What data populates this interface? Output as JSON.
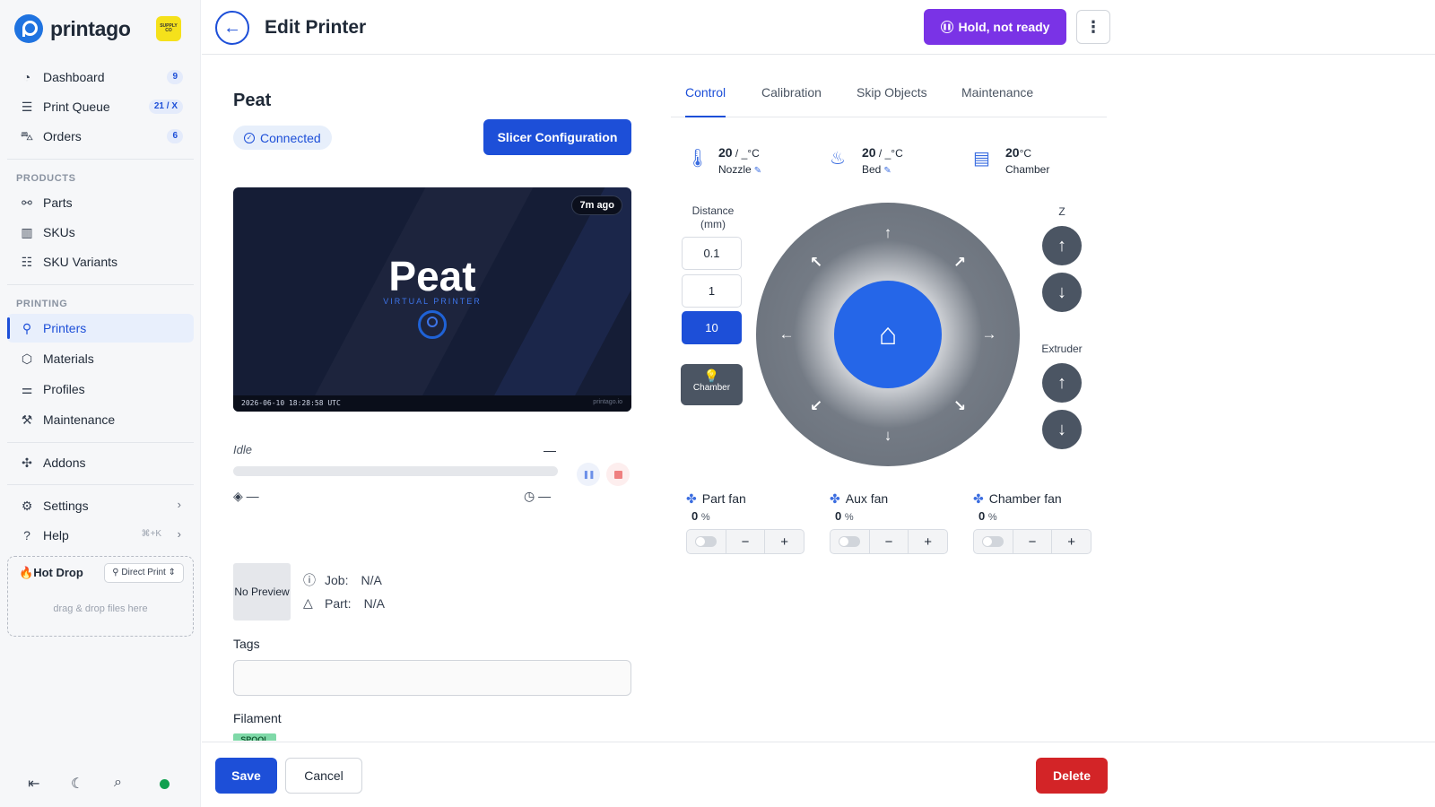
{
  "brand": {
    "name": "printago",
    "org_badge": "SUPPLY CO"
  },
  "sidebar": {
    "main": [
      {
        "label": "Dashboard",
        "count": "9",
        "icon": "gauge-icon"
      },
      {
        "label": "Print Queue",
        "count": "21 / X",
        "icon": "queue-icon"
      },
      {
        "label": "Orders",
        "count": "6",
        "icon": "cart-icon"
      }
    ],
    "products_label": "PRODUCTS",
    "products": [
      {
        "label": "Parts",
        "icon": "parts-icon"
      },
      {
        "label": "SKUs",
        "icon": "barcode-icon"
      },
      {
        "label": "SKU Variants",
        "icon": "list-icon"
      }
    ],
    "printing_label": "PRINTING",
    "printing": [
      {
        "label": "Printers",
        "icon": "printer-icon",
        "active": true
      },
      {
        "label": "Materials",
        "icon": "cube-icon"
      },
      {
        "label": "Profiles",
        "icon": "sliders-icon"
      },
      {
        "label": "Maintenance",
        "icon": "wrench-icon"
      }
    ],
    "addons": {
      "label": "Addons",
      "icon": "puzzle-icon"
    },
    "settings": {
      "label": "Settings",
      "icon": "gear-icon"
    },
    "help": {
      "label": "Help",
      "shortcut": "⌘+K",
      "icon": "help-icon"
    },
    "hotdrop": {
      "title": "Hot Drop",
      "mode": "Direct Print",
      "hint": "drag & drop files here"
    }
  },
  "header": {
    "title": "Edit Printer",
    "status_button": "Hold, not ready"
  },
  "printer": {
    "name": "Peat",
    "connection": "Connected",
    "slicer_button": "Slicer Configuration",
    "camera": {
      "title": "Peat",
      "subtitle": "VIRTUAL PRINTER",
      "age": "7m ago",
      "timestamp": "2026-06-10 18:28:58 UTC",
      "brand": "printago.io"
    },
    "state": "Idle",
    "state_value": "—",
    "progress": 0,
    "layers": "—",
    "time_remaining": "—",
    "preview": "No Preview",
    "job_label": "Job:",
    "job_value": "N/A",
    "part_label": "Part:",
    "part_value": "N/A",
    "tags_label": "Tags",
    "tags_value": "",
    "filament_label": "Filament",
    "filament_chip": "SPOOL"
  },
  "tabs": [
    "Control",
    "Calibration",
    "Skip Objects",
    "Maintenance"
  ],
  "control": {
    "temps": [
      {
        "value": "20",
        "target": " / _",
        "unit": "°C",
        "name": "Nozzle",
        "editable": true,
        "icon": "nozzle-icon"
      },
      {
        "value": "20",
        "target": " / _",
        "unit": "°C",
        "name": "Bed",
        "editable": true,
        "icon": "bed-heat-icon"
      },
      {
        "value": "20",
        "target": "",
        "unit": "°C",
        "name": "Chamber",
        "editable": false,
        "icon": "chamber-icon"
      }
    ],
    "distance_label": "Distance (mm)",
    "distances": [
      "0.1",
      "1",
      "10"
    ],
    "selected_distance": "10",
    "chamber_light": "Chamber",
    "z_label": "Z",
    "extruder_label": "Extruder",
    "fans": [
      {
        "name": "Part fan",
        "value": "0",
        "unit": "%"
      },
      {
        "name": "Aux fan",
        "value": "0",
        "unit": "%"
      },
      {
        "name": "Chamber fan",
        "value": "0",
        "unit": "%"
      }
    ]
  },
  "footer": {
    "save": "Save",
    "cancel": "Cancel",
    "delete": "Delete"
  },
  "colors": {
    "primary": "#1d4fd8",
    "hold": "#7a33e6",
    "danger": "#d32427",
    "jog": "#6e757f",
    "online": "#10a04f"
  }
}
